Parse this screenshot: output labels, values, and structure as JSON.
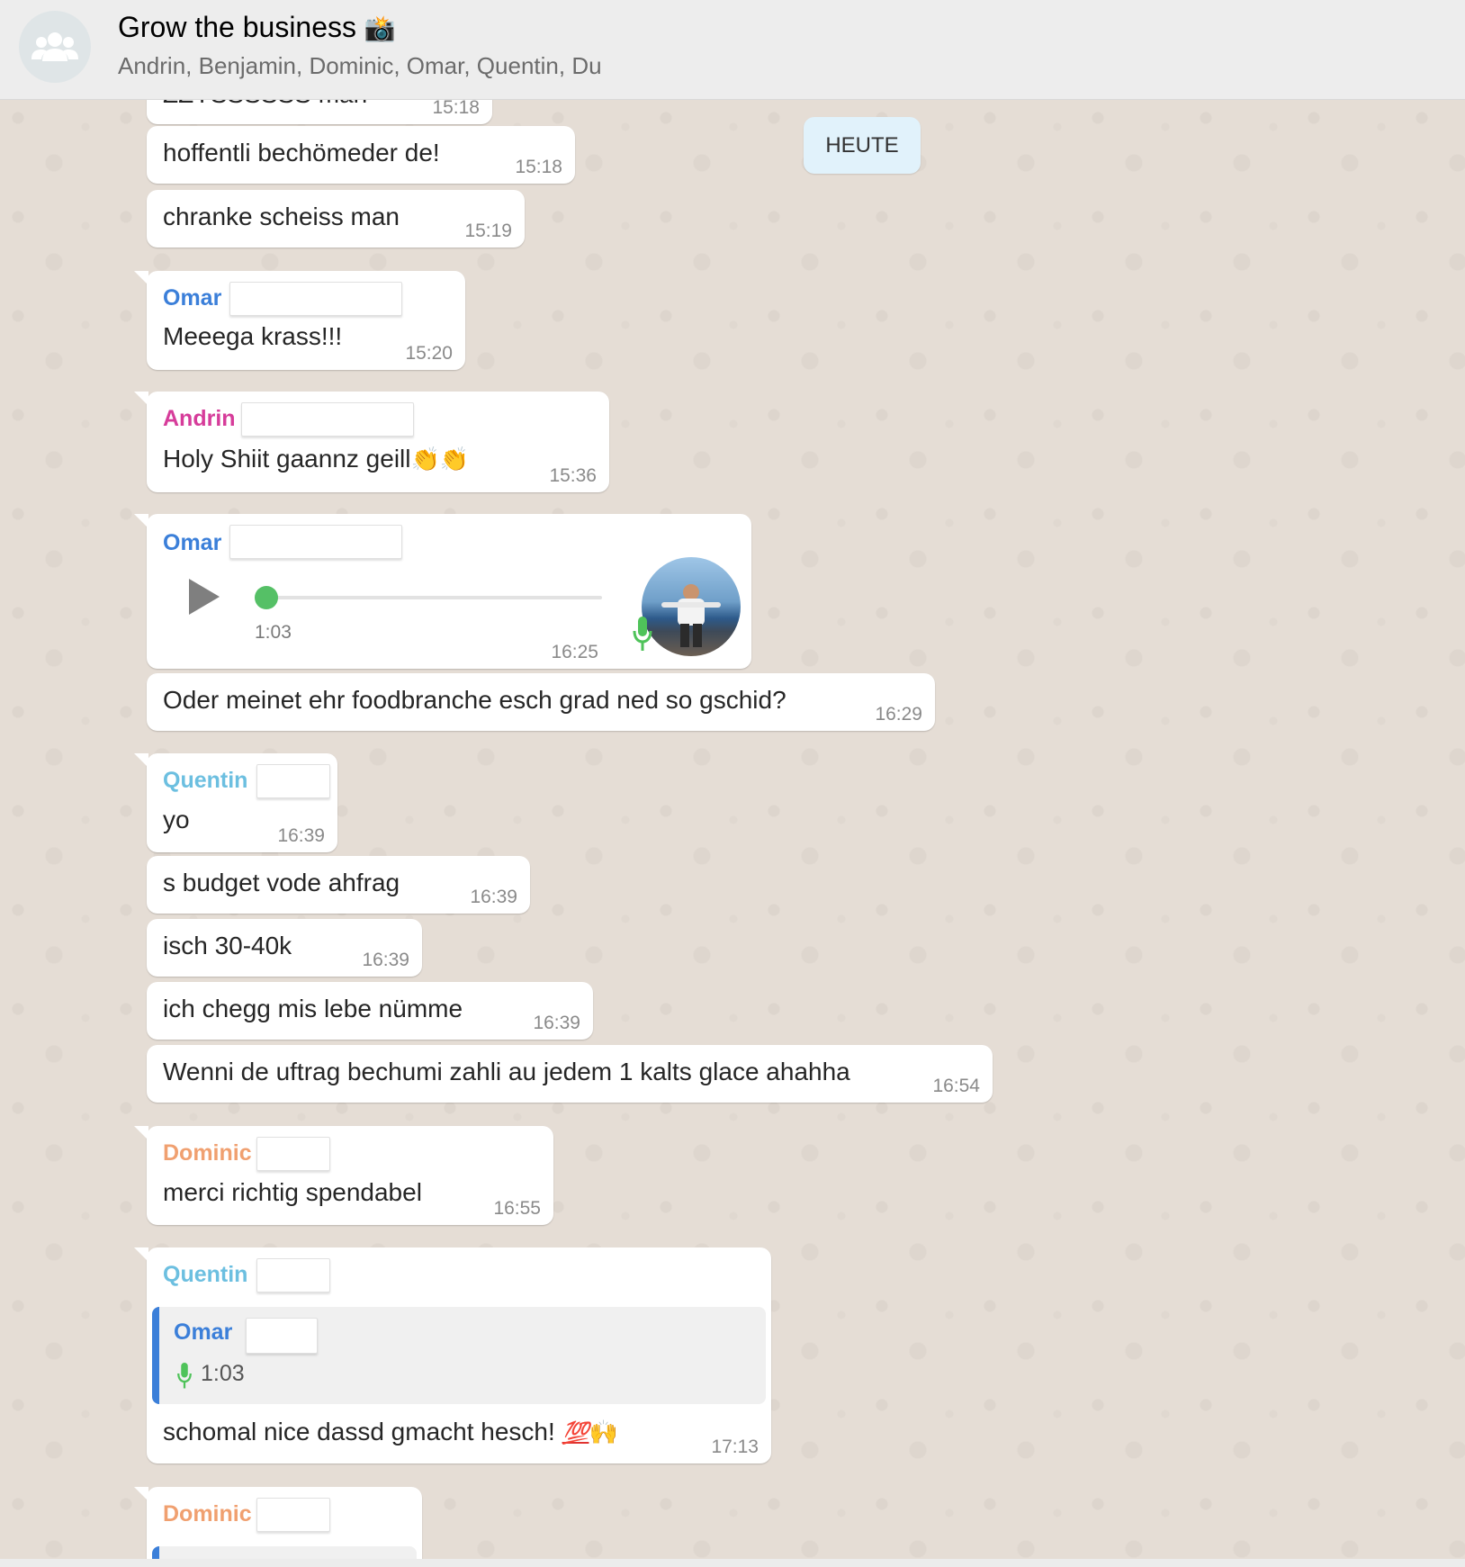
{
  "header": {
    "title": "Grow the business",
    "title_emoji": "📸",
    "participants": "Andrin, Benjamin, Dominic, Omar, Quentin, Du",
    "avatar_icon": "group-icon"
  },
  "day_chip": "HEUTE",
  "colors": {
    "omar": "#3b7fd9",
    "andrin": "#d63c9a",
    "quentin": "#6cbfe0",
    "dominic": "#f0a070",
    "voice_dot": "#55c066",
    "mic_green": "#4fc35a"
  },
  "messages": [
    {
      "text": "ZZYSSSSSS man",
      "time": "15:18"
    },
    {
      "text": "hoffentli bechömeder de!",
      "time": "15:18"
    },
    {
      "text": "chranke scheiss man",
      "time": "15:19"
    },
    {
      "sender": "Omar",
      "text": "Meeega krass!!!",
      "time": "15:20"
    },
    {
      "sender": "Andrin",
      "text": "Holy Shiit gaannz geill",
      "emoji": "👏👏",
      "time": "15:36"
    },
    {
      "sender": "Omar",
      "voice_duration": "1:03",
      "time": "16:25",
      "progress": 0,
      "play_icon": "play-icon",
      "mic_icon": "mic-icon"
    },
    {
      "text": "Oder meinet ehr foodbranche esch grad ned so gschid?",
      "time": "16:29"
    },
    {
      "sender": "Quentin",
      "text": "yo",
      "time": "16:39"
    },
    {
      "text": "s budget vode ahfrag",
      "time": "16:39"
    },
    {
      "text": "isch 30-40k",
      "time": "16:39"
    },
    {
      "text": "ich chegg mis lebe nümme",
      "time": "16:39"
    },
    {
      "text": "Wenni de uftrag bechumi zahli au jedem 1 kalts glace ahahha",
      "time": "16:54"
    },
    {
      "sender": "Dominic",
      "text": "merci richtig spendabel",
      "time": "16:55"
    },
    {
      "sender": "Quentin",
      "quote_sender": "Omar",
      "quote_duration": "1:03",
      "text": "schomal nice dassd gmacht hesch!",
      "emoji_100": "💯",
      "emoji_hands": "🙌",
      "time": "17:13"
    },
    {
      "sender": "Dominic"
    }
  ]
}
